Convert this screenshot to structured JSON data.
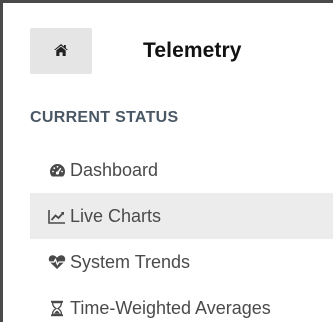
{
  "header": {
    "home_icon": "home-icon",
    "title": "Telemetry"
  },
  "section": {
    "title": "CURRENT STATUS"
  },
  "nav": {
    "active_index": 1,
    "items": [
      {
        "label": "Dashboard",
        "icon": "tachometer-icon"
      },
      {
        "label": "Live Charts",
        "icon": "line-chart-icon"
      },
      {
        "label": "System Trends",
        "icon": "heartbeat-icon"
      },
      {
        "label": "Time-Weighted Averages",
        "icon": "hourglass-icon"
      }
    ]
  },
  "colors": {
    "frame_border": "#4a4a4a",
    "active_bg": "#ececec",
    "home_button_bg": "#e5e5e5",
    "section_title": "#4a5866",
    "text": "#4a4a4a"
  }
}
